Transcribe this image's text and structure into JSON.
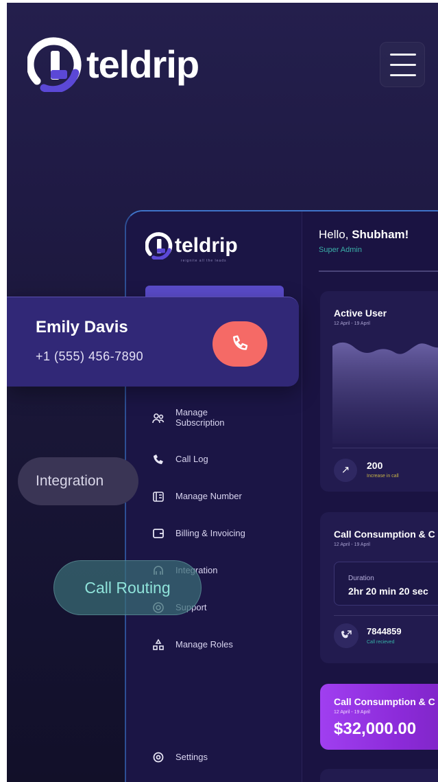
{
  "header": {
    "brand_name": "teldrip",
    "menu_icon": "hamburger-menu-icon"
  },
  "dashboard": {
    "brand_name": "teldrip",
    "brand_tagline": "reignite all the leads",
    "sidebar": {
      "items": [
        {
          "label": "Manage Subscription",
          "icon": "users-icon"
        },
        {
          "label": "Call Log",
          "icon": "call-log-icon"
        },
        {
          "label": "Manage Number",
          "icon": "number-icon"
        },
        {
          "label": "Billing & Invoicing",
          "icon": "wallet-icon"
        },
        {
          "label": "Integration",
          "icon": "integration-icon"
        },
        {
          "label": "Support",
          "icon": "support-icon"
        },
        {
          "label": "Manage Roles",
          "icon": "roles-icon"
        },
        {
          "label": "Settings",
          "icon": "settings-icon"
        }
      ]
    },
    "greeting": {
      "prefix": "Hello, ",
      "name": "Shubham!",
      "role": "Super Admin"
    },
    "active_user_card": {
      "title": "Active User",
      "date_range": "12 April - 19 April",
      "value": "200",
      "note": "Increase in call"
    },
    "consumption_card": {
      "title": "Call Consumption & C",
      "date_range": "12 April - 19 April",
      "duration_label": "Duration",
      "duration_value": "2hr 20 min 20 sec",
      "calls_value": "7844859",
      "calls_note": "Call recieved"
    },
    "amount_card": {
      "title": "Call Consumption & C",
      "date_range": "12 April - 19 April",
      "amount": "$32,000.00"
    }
  },
  "call_card": {
    "caller_name": "Emily Davis",
    "caller_number": "+1 (555) 456-7890",
    "end_call_icon": "phone-icon"
  },
  "feature_pills": {
    "integration": "Integration",
    "call_routing": "Call Routing"
  },
  "colors": {
    "background": "#1f1a44",
    "accent": "#5a4bc9",
    "call_button": "#f56a66",
    "amount_card": "#a03ff0",
    "teal": "#3bb0a9"
  }
}
